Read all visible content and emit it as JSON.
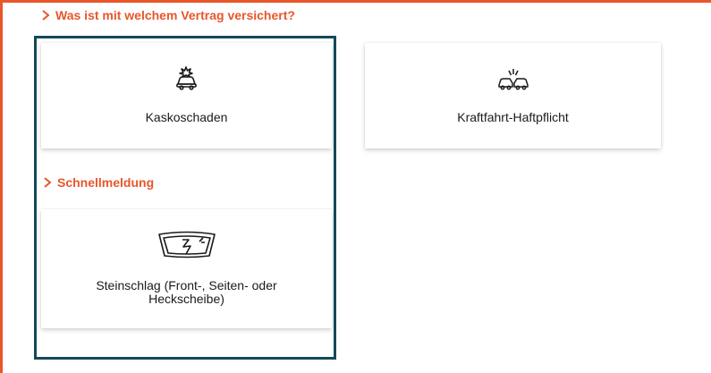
{
  "sections": {
    "vertrag": {
      "title": "Was ist mit welchem Vertrag versichert?"
    },
    "schnellmeldung": {
      "title": "Schnellmeldung"
    }
  },
  "cards": {
    "kasko": {
      "label": "Kaskoschaden",
      "icon": "car-crash-icon"
    },
    "kraftfahrt": {
      "label": "Kraftfahrt-Haftpflicht",
      "icon": "car-collision-icon"
    },
    "steinschlag": {
      "label": "Steinschlag (Front-, Seiten- oder Heckscheibe)",
      "icon": "cracked-windshield-icon"
    }
  },
  "colors": {
    "accent": "#e8562a",
    "selection_border": "#13495a",
    "text": "#1a1a1a"
  }
}
